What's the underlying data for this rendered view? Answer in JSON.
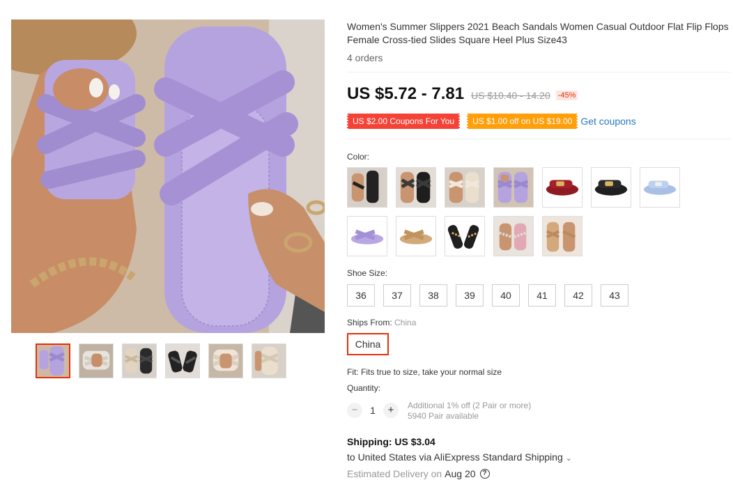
{
  "product": {
    "title": "Women's Summer Slippers 2021 Beach Sandals Women Casual Outdoor Flat Flip Flops Female Cross-tied Slides Square Heel Plus Size43",
    "orders": "4 orders"
  },
  "price": {
    "current": "US $5.72 - 7.81",
    "original": "US $10.40 - 14.20",
    "discount": "-45%"
  },
  "coupons": {
    "coupon_1": "US $2.00 Coupons For You",
    "coupon_2": "US $1.00 off on US $19.00",
    "get_label": "Get coupons"
  },
  "color": {
    "label": "Color:",
    "options": [
      {
        "icon": "sandal-black-worn"
      },
      {
        "icon": "sandal-black-crossed"
      },
      {
        "icon": "sandal-beige-worn"
      },
      {
        "icon": "sandal-purple-worn"
      },
      {
        "icon": "sandal-red-buckle"
      },
      {
        "icon": "sandal-black-buckle"
      },
      {
        "icon": "sandal-lightblue"
      },
      {
        "icon": "sandal-purple"
      },
      {
        "icon": "sandal-tan"
      },
      {
        "icon": "sandal-black-chain"
      },
      {
        "icon": "sandal-pink-chain"
      },
      {
        "icon": "sandal-brown-worn"
      }
    ]
  },
  "size": {
    "label": "Shoe Size:",
    "options": [
      "36",
      "37",
      "38",
      "39",
      "40",
      "41",
      "42",
      "43"
    ]
  },
  "ships_from": {
    "label": "Ships From: ",
    "value": "China",
    "selected": "China"
  },
  "fit": "Fit: Fits true to size, take your normal size",
  "quantity": {
    "label": "Quantity:",
    "value": "1",
    "minus": "−",
    "plus": "+",
    "note_1": "Additional 1% off (2 Pair or more)",
    "note_2": "5940 Pair available"
  },
  "shipping": {
    "cost": "Shipping: US $3.04",
    "to": "to United States via AliExpress Standard Shipping",
    "delivery_label": "Estimated Delivery on",
    "delivery_date": "Aug 20",
    "help": "?"
  },
  "colors": {
    "accent": "#e62e04",
    "coupon_red": "#f44336",
    "coupon_orange": "#ff9f0a",
    "link": "#2a7ac0",
    "product_purple": "#b7a4df"
  }
}
